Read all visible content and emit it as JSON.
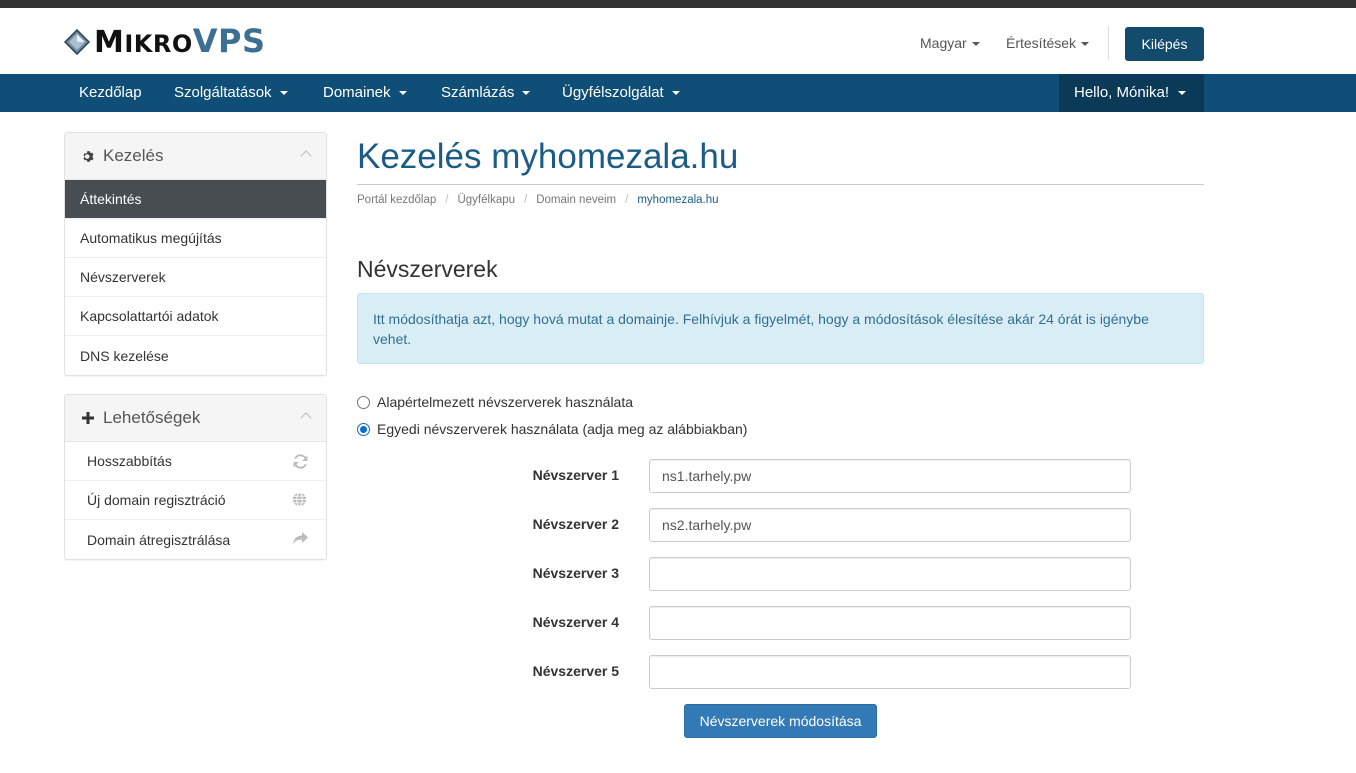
{
  "header": {
    "logo": "MikroVPS",
    "language": "Magyar",
    "notifications": "Értesítések",
    "logout": "Kilépés"
  },
  "nav": {
    "items": [
      {
        "label": "Kezdőlap",
        "dropdown": false
      },
      {
        "label": "Szolgáltatások",
        "dropdown": true
      },
      {
        "label": "Domainek",
        "dropdown": true
      },
      {
        "label": "Számlázás",
        "dropdown": true
      },
      {
        "label": "Ügyfélszolgálat",
        "dropdown": true
      }
    ],
    "user": "Hello, Mónika!"
  },
  "sidebar": {
    "manage": {
      "title": "Kezelés",
      "icon": "gear-icon",
      "items": [
        "Áttekintés",
        "Automatikus megújítás",
        "Névszerverek",
        "Kapcsolattartói adatok",
        "DNS kezelése"
      ],
      "active_index": 0
    },
    "options": {
      "title": "Lehetőségek",
      "icon": "plus-icon",
      "items": [
        {
          "label": "Hosszabbítás",
          "icon": "refresh-icon"
        },
        {
          "label": "Új domain regisztráció",
          "icon": "globe-icon"
        },
        {
          "label": "Domain átregisztrálása",
          "icon": "share-arrow-icon"
        }
      ]
    }
  },
  "main": {
    "title": "Kezelés myhomezala.hu",
    "breadcrumb": [
      "Portál kezdőlap",
      "Ügyfélkapu",
      "Domain neveim",
      "myhomezala.hu"
    ],
    "section_title": "Névszerverek",
    "info": "Itt módosíthatja azt, hogy hová mutat a domainje. Felhívjuk a figyelmét, hogy a módosítások élesítése akár 24 órát is igénybe vehet.",
    "radio_default": "Alapértelmezett névszerverek használata",
    "radio_custom": "Egyedi névszerverek használata (adja meg az alábbiakban)",
    "selected_option": "custom",
    "nameservers": [
      {
        "label": "Névszerver 1",
        "value": "ns1.tarhely.pw"
      },
      {
        "label": "Névszerver 2",
        "value": "ns2.tarhely.pw"
      },
      {
        "label": "Névszerver 3",
        "value": ""
      },
      {
        "label": "Névszerver 4",
        "value": ""
      },
      {
        "label": "Névszerver 5",
        "value": ""
      }
    ],
    "submit": "Névszerverek módosítása"
  },
  "colors": {
    "navbar": "#0f4f77",
    "navbar_user": "#0b3a59",
    "title": "#1b5c87",
    "button": "#337ab7",
    "alert_bg": "#d9edf7"
  }
}
